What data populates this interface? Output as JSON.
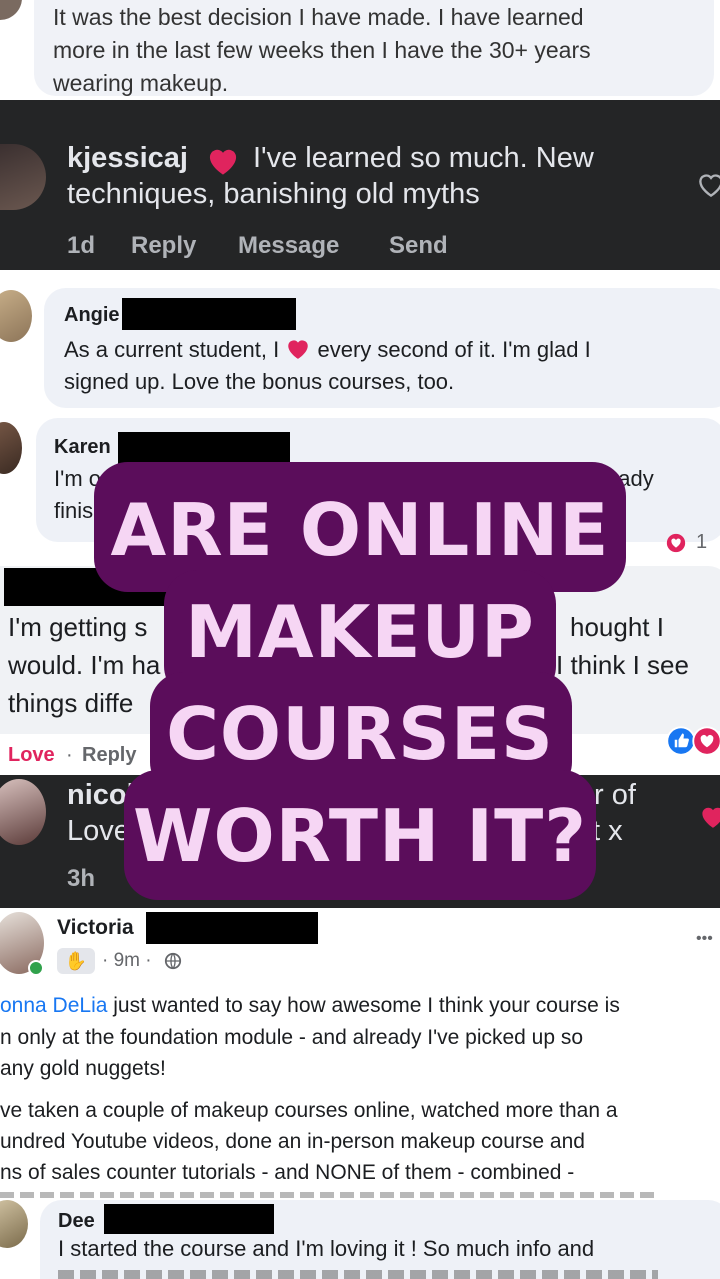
{
  "comment1": {
    "line1": "It was the best decision I have made. I have learned",
    "line2": "more in the last few weeks then I have the 30+ years",
    "line3": "wearing makeup."
  },
  "comment2": {
    "username": "kjessicaj",
    "line1": "I've learned so much. New",
    "line2": "techniques, banishing old myths",
    "time": "1d",
    "reply": "Reply",
    "message": "Message",
    "send": "Send"
  },
  "comment3": {
    "name": "Angie",
    "line1_a": "As a current student, I",
    "line1_b": "every second of it. I'm glad I",
    "line2": "signed up. Love the bonus courses, too."
  },
  "comment4": {
    "name": "Karen",
    "line1_a": "I'm o",
    "line1_b": "eady",
    "line2": "finis",
    "reaction_count": "1"
  },
  "comment5": {
    "line1_a": "I'm getting s",
    "line1_b": "hought I",
    "line2_a": "would. I'm ha",
    "line2_b": "I think I see",
    "line3": "things diffe",
    "love": "Love",
    "dot": "·",
    "reply": "Reply"
  },
  "comment6": {
    "name_partial": "nicol",
    "right_partial": "r of",
    "line2_partial": "Love",
    "line2_right": "t x",
    "time": "3h"
  },
  "comment7": {
    "name": "Victoria",
    "time": "· 9m ·",
    "more": "•••",
    "mention": "onna DeLia",
    "p1_line1": " just wanted to say how awesome I think your course is",
    "p1_line2": "n only at the foundation module - and already I've picked up so",
    "p1_line3": "any gold nuggets!",
    "p2_line1": "ve taken a couple of makeup courses online, watched more than a",
    "p2_line2": "undred Youtube videos, done an in-person makeup course and",
    "p2_line3": "ns of sales counter tutorials - and NONE of them - combined -"
  },
  "comment8": {
    "name": "Dee",
    "line1": "I started the course and I'm loving it ! So much info and"
  },
  "overlay": {
    "line1": "ARE ONLINE",
    "line2": "MAKEUP",
    "line3": "COURSES",
    "line4": "WORTH IT?"
  },
  "colors": {
    "overlay_bg": "#5b0d5b",
    "overlay_text": "#f6d6f4",
    "dark_panel": "#242526",
    "heart": "#e0245e",
    "link_blue": "#1877f2"
  }
}
